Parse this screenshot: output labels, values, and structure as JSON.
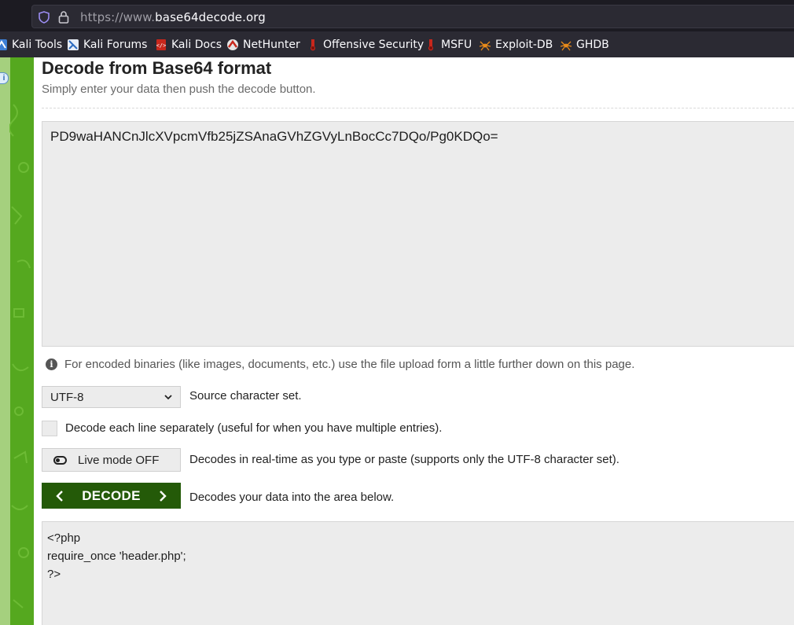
{
  "browser": {
    "url_prefix": "https://www.",
    "url_domain": "base64decode.org",
    "bookmarks": [
      {
        "label": "Kali Tools",
        "icon": "kali-dragon-icon"
      },
      {
        "label": "Kali Forums",
        "icon": "kali-dragon-icon"
      },
      {
        "label": "Kali Docs",
        "icon": "kali-docs-icon"
      },
      {
        "label": "NetHunter",
        "icon": "nethunter-icon"
      },
      {
        "label": "Offensive Security",
        "icon": "offsec-icon"
      },
      {
        "label": "MSFU",
        "icon": "offsec-icon"
      },
      {
        "label": "Exploit-DB",
        "icon": "spider-icon"
      },
      {
        "label": "GHDB",
        "icon": "spider-icon"
      }
    ]
  },
  "page": {
    "title": "Decode from Base64 format",
    "subtitle": "Simply enter your data then push the decode button.",
    "input_value": "PD9waHANCnJlcXVpcmVfb25jZSAnaGVhZGVyLnBocCc7DQo/Pg0KDQo=",
    "note": "For encoded binaries (like images, documents, etc.) use the file upload form a little further down on this page.",
    "charset": {
      "selected": "UTF-8",
      "label": "Source character set."
    },
    "line_option": {
      "label": "Decode each line separately (useful for when you have multiple entries)."
    },
    "live_mode": {
      "button": "Live mode OFF",
      "label": "Decodes in real-time as you type or paste (supports only the UTF-8 character set)."
    },
    "decode": {
      "button": "DECODE",
      "label": "Decodes your data into the area below."
    },
    "output_lines": [
      "<?php",
      "require_once 'header.php';",
      "?>"
    ]
  },
  "colors": {
    "accent_green": "#245a08",
    "sidebar_green": "#55a81f",
    "field_bg": "#ececec"
  }
}
